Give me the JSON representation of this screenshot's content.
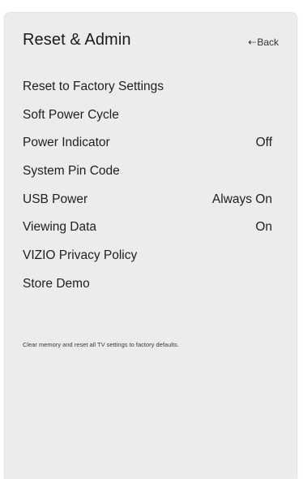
{
  "header": {
    "title": "Reset & Admin",
    "back_label": "Back",
    "back_icon": "arrow-left-icon"
  },
  "menu": {
    "items": [
      {
        "label": "Reset to Factory Settings",
        "value": ""
      },
      {
        "label": "Soft Power Cycle",
        "value": ""
      },
      {
        "label": "Power Indicator",
        "value": "Off"
      },
      {
        "label": "System Pin Code",
        "value": ""
      },
      {
        "label": "USB Power",
        "value": "Always On"
      },
      {
        "label": "Viewing Data",
        "value": "On"
      },
      {
        "label": "VIZIO Privacy Policy",
        "value": ""
      },
      {
        "label": "Store Demo",
        "value": ""
      }
    ]
  },
  "description": "Clear memory and reset all TV settings to factory defaults.",
  "colors": {
    "panel_background": "#ececec",
    "text": "#1f1f1f"
  }
}
